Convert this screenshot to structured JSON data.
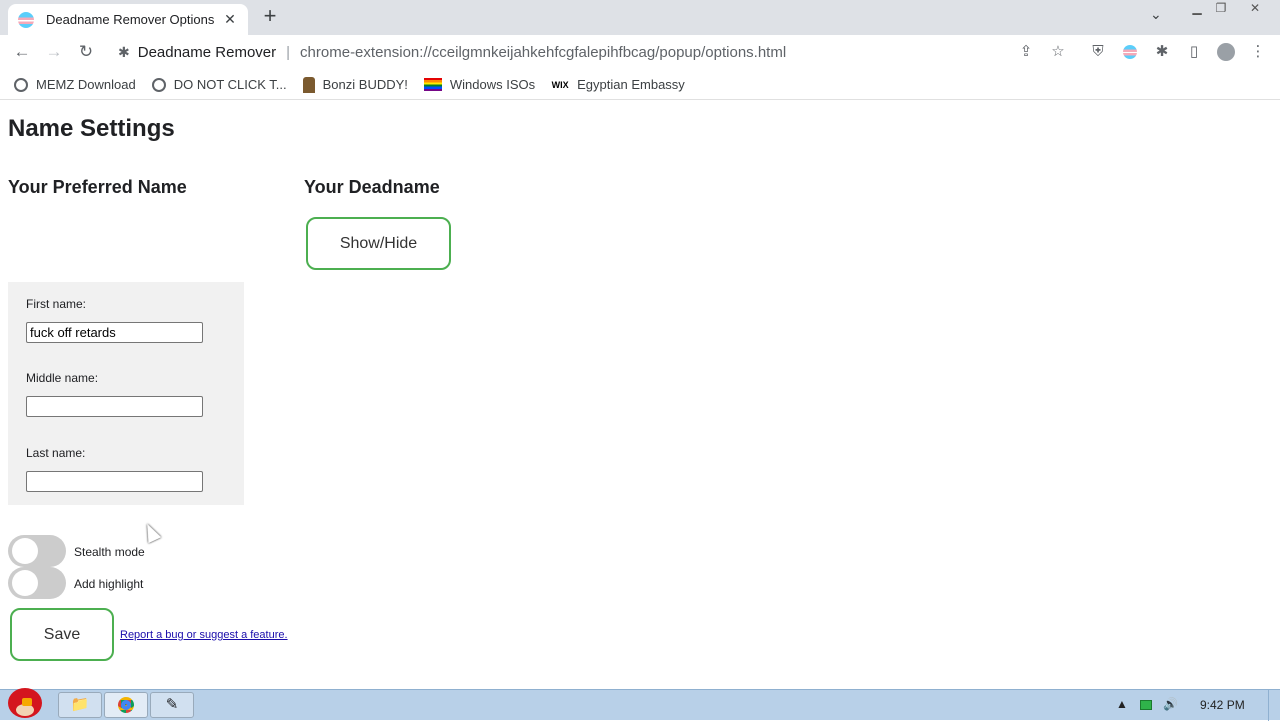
{
  "browser": {
    "tab_title": "Deadname Remover Options",
    "tab_close": "✕",
    "new_tab": "+",
    "tab_menu": "⌄",
    "omnibox_site": "Deadname Remover",
    "omnibox_sep": "|",
    "omnibox_url": "chrome-extension://cceilgmnkeijahkehfcgfalepihfbcag/popup/options.html",
    "bookmarks": [
      {
        "label": "MEMZ Download",
        "icon": "globe-icon"
      },
      {
        "label": "DO NOT CLICK T...",
        "icon": "globe-icon"
      },
      {
        "label": "Bonzi BUDDY!",
        "icon": "bonzi-icon"
      },
      {
        "label": "Windows ISOs",
        "icon": "rainbow-icon"
      },
      {
        "label": "Egyptian Embassy",
        "icon": "wix-icon",
        "icon_text": "WIX"
      }
    ]
  },
  "page": {
    "title": "Name Settings",
    "preferred_heading": "Your Preferred Name",
    "deadname_heading": "Your Deadname",
    "show_hide_label": "Show/Hide",
    "first_name_label": "First name:",
    "first_name_value": "fuck off retards",
    "middle_name_label": "Middle name:",
    "middle_name_value": "",
    "last_name_label": "Last name:",
    "last_name_value": "",
    "stealth_label": "Stealth mode",
    "highlight_label": "Add highlight",
    "save_label": "Save",
    "report_link": "Report a bug or suggest a feature."
  },
  "taskbar": {
    "clock": "9:42 PM"
  },
  "colors": {
    "button_border": "#4caf50",
    "toggle_off": "#cccccc",
    "name_box_bg": "#f1f1f1"
  }
}
